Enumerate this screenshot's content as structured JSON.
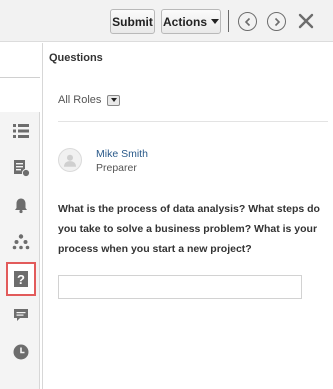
{
  "toolbar": {
    "submit_label": "Submit",
    "actions_label": "Actions",
    "prev_icon": "chevron-left-circle-icon",
    "next_icon": "chevron-right-circle-icon",
    "close_icon": "close-icon"
  },
  "rail": {
    "items": [
      {
        "name": "list-icon"
      },
      {
        "name": "document-icon"
      },
      {
        "name": "bell-icon"
      },
      {
        "name": "hierarchy-icon"
      },
      {
        "name": "question-icon",
        "active": true
      },
      {
        "name": "comment-icon"
      },
      {
        "name": "clock-icon"
      }
    ],
    "active_color": "#e25b5b"
  },
  "panel": {
    "title": "Questions",
    "roles_filter": "All Roles",
    "user": {
      "name": "Mike Smith",
      "role": "Preparer"
    },
    "question_text": "What is the process of data analysis? What steps do you take to solve a business problem? What is your process when you start a new project?",
    "answer_value": ""
  },
  "colors": {
    "link": "#2a5a8a",
    "toolbar_bg": "#f2f2f2"
  }
}
